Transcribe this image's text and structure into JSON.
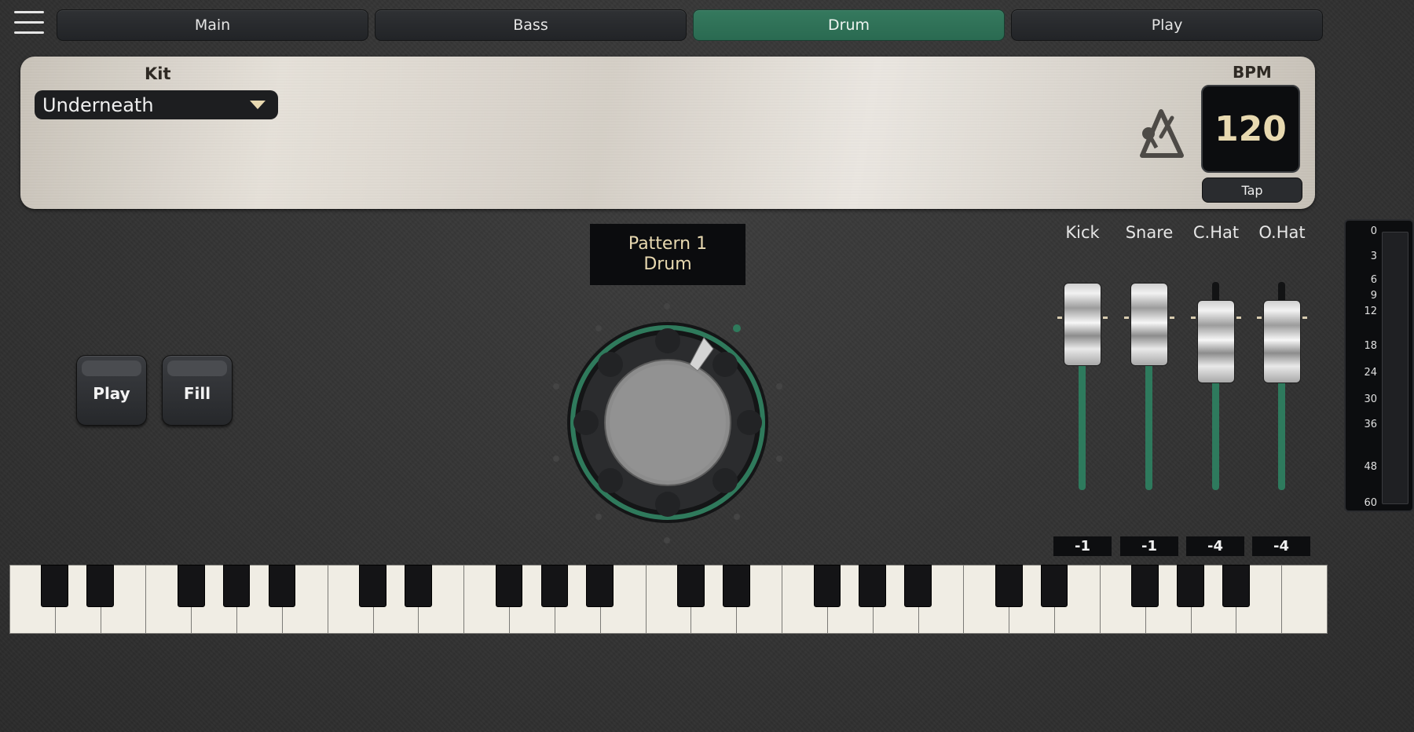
{
  "header": {
    "menu_icon": "hamburger-menu-icon",
    "tabs": [
      {
        "label": "Main",
        "active": false
      },
      {
        "label": "Bass",
        "active": false
      },
      {
        "label": "Drum",
        "active": true
      },
      {
        "label": "Play",
        "active": false
      }
    ]
  },
  "panel": {
    "kit_label": "Kit",
    "kit_value": "Underneath",
    "metronome_icon": "metronome-icon",
    "bpm_label": "BPM",
    "bpm_value": "120",
    "tap_label": "Tap"
  },
  "pattern": {
    "line1": "Pattern 1",
    "line2": "Drum"
  },
  "pads": {
    "play_label": "Play",
    "fill_label": "Fill"
  },
  "mixer": {
    "channels": [
      {
        "name": "Kick",
        "value": "-1",
        "level": 0.0
      },
      {
        "name": "Snare",
        "value": "-1",
        "level": 0.0
      },
      {
        "name": "C.Hat",
        "value": "-4",
        "level": -4
      },
      {
        "name": "O.Hat",
        "value": "-4",
        "level": -4
      }
    ]
  },
  "meter": {
    "ticks": [
      "0",
      "3",
      "6",
      "9",
      "12",
      "18",
      "24",
      "30",
      "36",
      "48",
      "60"
    ]
  },
  "colors": {
    "accent_green": "#2f7a5c",
    "display_text": "#e8d9b0",
    "panel_metal": "#e0dbd3"
  }
}
